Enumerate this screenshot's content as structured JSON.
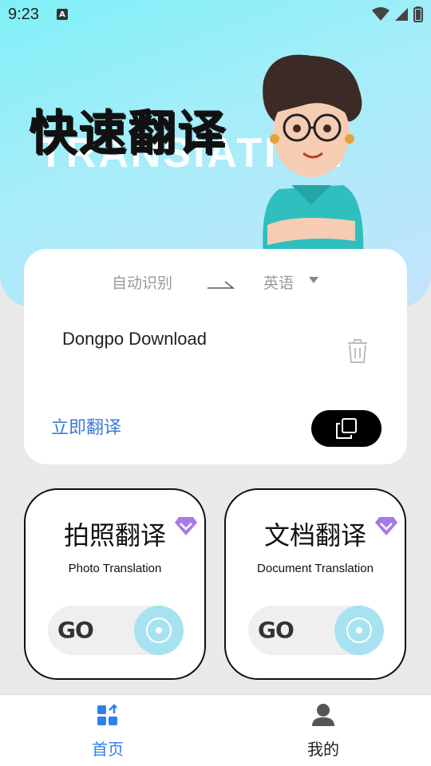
{
  "status_bar": {
    "time": "9:23",
    "notification_icon": "A"
  },
  "hero": {
    "title": "快速翻译",
    "background_word": "TRANSIATION"
  },
  "translate_card": {
    "source_language": "自动识别",
    "target_language": "英语",
    "input_text": "Dongpo Download",
    "translate_action": "立即翻译"
  },
  "features": [
    {
      "title": "拍照翻译",
      "subtitle": "Photo Translation",
      "go_label": "GO"
    },
    {
      "title": "文档翻译",
      "subtitle": "Document Translation",
      "go_label": "GO"
    }
  ],
  "tabbar": {
    "items": [
      {
        "label": "首页"
      },
      {
        "label": "我的"
      }
    ]
  },
  "colors": {
    "accent": "#2f80ed",
    "link": "#3a7bd5",
    "hero_start": "#7ff0f7",
    "hero_end": "#c4e3fb",
    "gem": "#a77be6",
    "go_circle": "#a7e2f0"
  },
  "icons": [
    "wifi-icon",
    "signal-icon",
    "battery-icon",
    "swap-arrow-icon",
    "dropdown-caret-icon",
    "trash-icon",
    "copy-icon",
    "premium-gem-icon",
    "target-icon",
    "home-grid-icon",
    "user-icon"
  ]
}
